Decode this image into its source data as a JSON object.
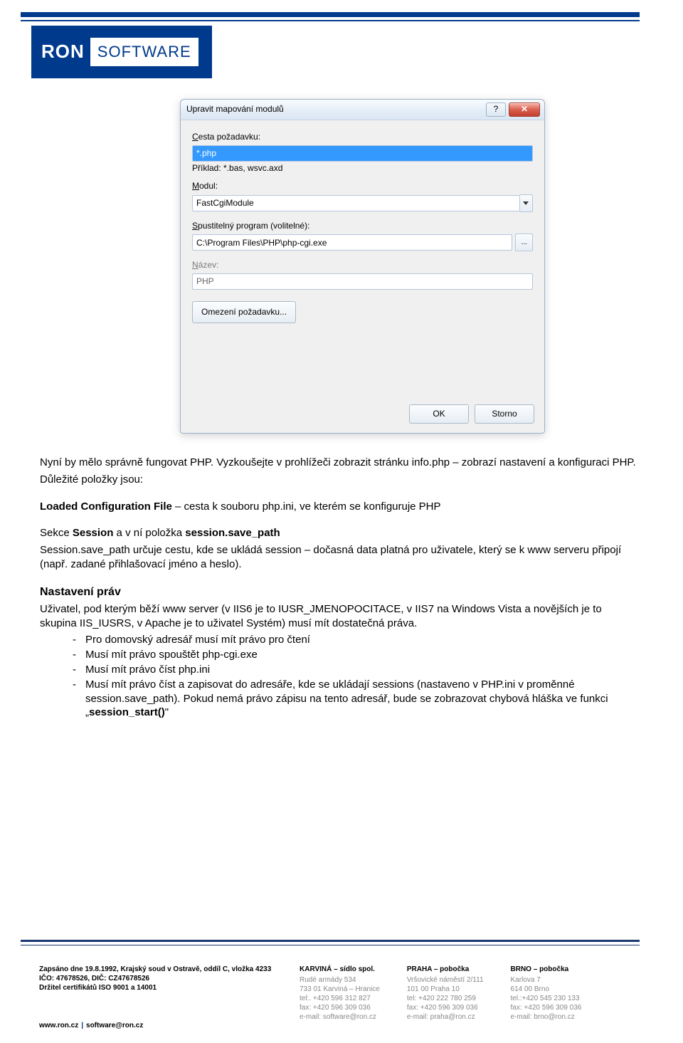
{
  "dialog": {
    "title": "Upravit mapování modulů",
    "help_icon": "?",
    "close_icon": "✕",
    "field1": {
      "label_pre": "C",
      "label_u": "esta požadavku:",
      "value": "*.php"
    },
    "hint": "Příklad: *.bas, wsvc.axd",
    "field2": {
      "label_u": "M",
      "label_post": "odul:",
      "value": "FastCgiModule"
    },
    "field3": {
      "label_u": "S",
      "label_post": "pustitelný program (volitelné):",
      "value": "C:\\Program Files\\PHP\\php-cgi.exe",
      "browse": "..."
    },
    "field4": {
      "label_u": "N",
      "label_post": "ázev:",
      "value": "PHP"
    },
    "limit_btn_pre": "Ome",
    "limit_btn_u": "z",
    "limit_btn_post": "ení požadavku...",
    "ok": "OK",
    "cancel": "Storno"
  },
  "text": {
    "p1": "Nyní by mělo správně fungovat PHP. Vyzkoušejte v prohlížeči zobrazit stránku info.php – zobrazí nastavení a konfiguraci PHP.",
    "p2": "Důležité položky jsou:",
    "p3a": "Loaded Configuration File",
    "p3b": " – cesta k souboru php.ini, ve kterém se konfiguruje PHP",
    "p4a": "Sekce ",
    "p4b": "Session",
    "p4c": " a v ní položka ",
    "p4d": "session.save_path",
    "p5": "Session.save_path určuje cestu, kde se ukládá session – dočasná data platná pro uživatele, který se k www serveru připojí (např. zadané přihlašovací jméno a heslo).",
    "h": "Nastavení práv",
    "p6": "Uživatel, pod kterým běží www server (v IIS6 je to IUSR_JMENOPOCITACE, v IIS7 na Windows Vista a novějších je to skupina IIS_IUSRS, v Apache je to uživatel Systém) musí mít dostatečná práva.",
    "li1": "Pro domovský adresář musí mít právo pro čtení",
    "li2": "Musí mít právo spouštět php-cgi.exe",
    "li3": "Musí mít právo číst php.ini",
    "li4a": "Musí mít právo číst a zapisovat do adresáře, kde se ukládají sessions (nastaveno v PHP.ini v proměnné session.save_path). Pokud nemá právo zápisu na tento adresář, bude se zobrazovat chybová hláška ve funkci „",
    "li4b": "session_start()",
    "li4c": "\""
  },
  "footer": {
    "reg1": "Zapsáno dne 19.8.1992, Krajský soud v Ostravě, oddíl C, vložka 4233",
    "reg2": "IČO: 47678526, DIČ: CZ47678526",
    "reg3": "Držitel certifikátů ISO 9001 a 14001",
    "karvina": {
      "title": "KARVINÁ – sídlo spol.",
      "l1": "Rudé armády 534",
      "l2": "733 01 Karviná – Hranice",
      "l3": "tel:. +420 596 312 827",
      "l4": "fax: +420 596 309 036",
      "l5": "e-mail: software@ron.cz"
    },
    "praha": {
      "title": "PRAHA – pobočka",
      "l1": "Vršovické náměstí 2/111",
      "l2": "101 00 Praha 10",
      "l3": "tel: +420 222 780 259",
      "l4": "fax: +420 596 309 036",
      "l5": "e-mail: praha@ron.cz"
    },
    "brno": {
      "title": "BRNO – pobočka",
      "l1": "Karlova 7",
      "l2": "614 00 Brno",
      "l3": "tel.:+420 545 230 133",
      "l4": "fax: +420 596 309 036",
      "l5": "e-mail: brno@ron.cz"
    },
    "site1": "www.ron.cz",
    "site2": "software@ron.cz"
  },
  "logo": {
    "ron": "RON",
    "sw": "SOFTWARE"
  }
}
